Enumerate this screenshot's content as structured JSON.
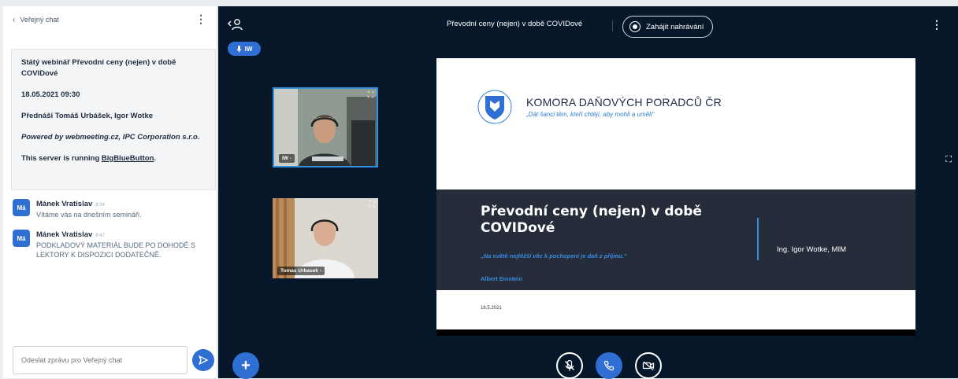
{
  "chat": {
    "back_label": "Veřejný chat",
    "welcome": {
      "title": "Státý webinář Převodní ceny (nejen) v době COVIDové",
      "datetime": "18.05.2021 09:30",
      "presenters": "Přednáší Tomáš Urbášek, Igor Wotke",
      "powered_by": "Powered by webmeeting.cz, IPC Corporation s.r.o.",
      "server_prefix": "This server is running ",
      "server_link": "BigBlueButton",
      "server_suffix": "."
    },
    "messages": [
      {
        "avatar": "Má",
        "name": "Mánek Vratislav",
        "time": "9:34",
        "text": "Vítáme vás na dnešním semináři."
      },
      {
        "avatar": "Má",
        "name": "Mánek Vratislav",
        "time": "9:47",
        "text": "PODKLADOVÝ MATERIÁL BUDE PO DOHODĚ S LEKTORY K DISPOZICI DODATEČNĚ."
      }
    ],
    "input_placeholder": "Odeslat zprávu pro Veřejný chat"
  },
  "header": {
    "talker_label": "IW",
    "meeting_title": "Převodní ceny (nejen) v době COVIDové",
    "record_label": "Zahájit nahrávání"
  },
  "videos": [
    {
      "label": "IW -"
    },
    {
      "label": "Tomas Urbasek -"
    }
  ],
  "slide": {
    "org_name": "KOMORA DAŇOVÝCH PORADCŮ ČR",
    "motto": "„Dát šanci těm, kteří chtějí, aby mohli a uměli“",
    "title": "Převodní ceny (nejen) v době COVIDové",
    "quote": "„Na světě nejtěžší věc k pochopení je daň z příjmu.“",
    "quote_author": "Albert Einstein",
    "speaker": "Ing. Igor Wotke, MIM",
    "date": "18.5.2021"
  },
  "colors": {
    "accent": "#2f6fd3",
    "main_bg": "#06172a",
    "slide_band": "#252c3a"
  }
}
